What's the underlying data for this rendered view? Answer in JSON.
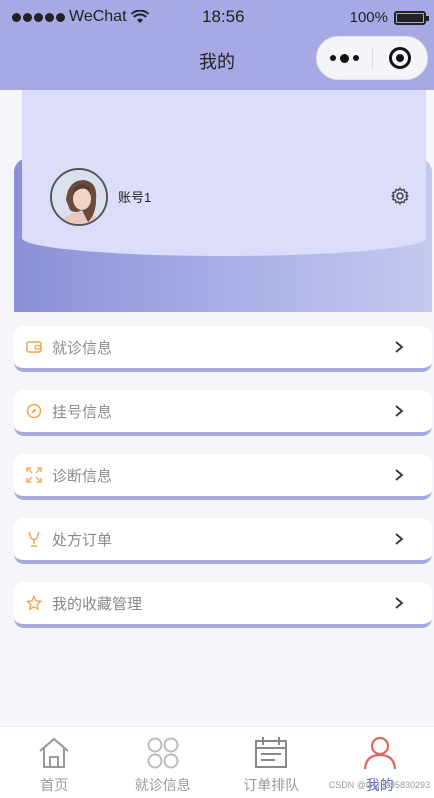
{
  "status_bar": {
    "carrier": "WeChat",
    "time": "18:56",
    "battery": "100%"
  },
  "nav": {
    "title": "我的"
  },
  "profile": {
    "username": "账号1"
  },
  "menu": [
    {
      "label": "就诊信息",
      "icon": "wallet-icon"
    },
    {
      "label": "挂号信息",
      "icon": "compass-icon"
    },
    {
      "label": "诊断信息",
      "icon": "expand-icon"
    },
    {
      "label": "处方订单",
      "icon": "trophy-icon"
    },
    {
      "label": "我的收藏管理",
      "icon": "star-icon"
    }
  ],
  "tabs": [
    {
      "label": "首页",
      "icon": "home-icon"
    },
    {
      "label": "就诊信息",
      "icon": "grid-icon"
    },
    {
      "label": "订单排队",
      "icon": "calendar-icon"
    },
    {
      "label": "我的",
      "icon": "user-icon",
      "active": true
    }
  ],
  "watermark": "CSDN @QQ3295830293",
  "colors": {
    "header": "#a6a9e4",
    "accent": "#a7a9e3",
    "icon_orange": "#f0a64a",
    "active_tab": "#e0685a"
  }
}
